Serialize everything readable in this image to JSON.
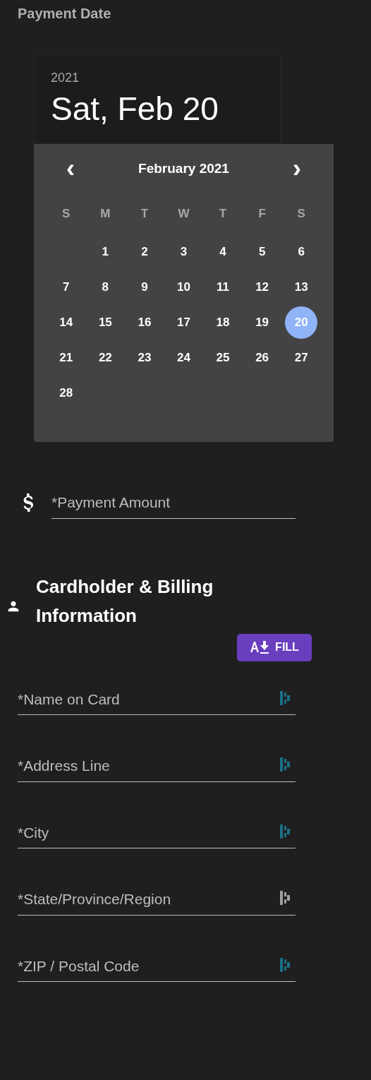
{
  "payment_date": {
    "label": "Payment Date",
    "picker": {
      "year": "2021",
      "date": "Sat, Feb 20",
      "month": "February 2021",
      "prev": "‹",
      "next": "›",
      "weekdays": [
        "S",
        "M",
        "T",
        "W",
        "T",
        "F",
        "S"
      ],
      "weeks": [
        [
          {
            "label": "1",
            "selected": false
          },
          {
            "label": "2",
            "selected": false
          },
          {
            "label": "3",
            "selected": false
          },
          {
            "label": "4",
            "selected": false
          },
          {
            "label": "5",
            "selected": false
          },
          {
            "label": "6",
            "selected": false
          }
        ],
        [
          {
            "label": "7",
            "selected": false
          },
          {
            "label": "8",
            "selected": false
          },
          {
            "label": "9",
            "selected": false
          },
          {
            "label": "10",
            "selected": false
          },
          {
            "label": "11",
            "selected": false
          },
          {
            "label": "12",
            "selected": false
          },
          {
            "label": "13",
            "selected": false
          }
        ],
        [
          {
            "label": "14",
            "selected": false
          },
          {
            "label": "15",
            "selected": false
          },
          {
            "label": "16",
            "selected": false
          },
          {
            "label": "17",
            "selected": false
          },
          {
            "label": "18",
            "selected": false
          },
          {
            "label": "19",
            "selected": false
          },
          {
            "label": "20",
            "selected": true
          }
        ],
        [
          {
            "label": "21",
            "selected": false
          },
          {
            "label": "22",
            "selected": false
          },
          {
            "label": "23",
            "selected": false
          },
          {
            "label": "24",
            "selected": false
          },
          {
            "label": "25",
            "selected": false
          },
          {
            "label": "26",
            "selected": false
          },
          {
            "label": "27",
            "selected": false
          }
        ],
        [
          {
            "label": "28",
            "selected": false
          }
        ]
      ]
    }
  },
  "payment_amount": {
    "placeholder": "*Payment Amount"
  },
  "cardholder": {
    "title": "Cardholder & Billing Information",
    "fill_button": "FILL",
    "fields": [
      {
        "placeholder": "*Name on Card",
        "color": "#1a6f86"
      },
      {
        "placeholder": "*Address Line",
        "color": "#1a6f86"
      },
      {
        "placeholder": "*City",
        "color": "#1a6f86"
      },
      {
        "placeholder": "*State/Province/Region",
        "color": "#a0a0a0"
      },
      {
        "placeholder": "*ZIP / Postal Code",
        "color": "#1a6f86"
      }
    ]
  }
}
